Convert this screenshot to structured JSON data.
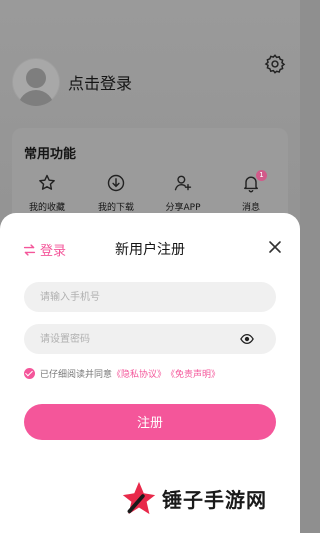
{
  "background_page": {
    "login_prompt": "点击登录",
    "common_functions_title": "常用功能",
    "functions": [
      {
        "label": "我的收藏",
        "icon": "star-icon"
      },
      {
        "label": "我的下载",
        "icon": "download-icon"
      },
      {
        "label": "分享APP",
        "icon": "add-user-icon"
      },
      {
        "label": "消息",
        "icon": "bell-icon",
        "badge": "1"
      }
    ]
  },
  "sheet": {
    "switch_login_label": "登录",
    "title": "新用户注册",
    "phone_placeholder": "请输入手机号",
    "password_placeholder": "请设置密码",
    "agreement_prefix": "已仔细阅读并同意",
    "privacy_link": "《隐私协议》",
    "disclaimer_link": "《免责声明》",
    "agreement_checked": true,
    "register_button": "注册"
  },
  "watermark": {
    "text": "锤子手游网"
  },
  "colors": {
    "accent": "#f4569a",
    "input_bg": "#f0f0f0",
    "overlay": "#9a9a9a"
  }
}
